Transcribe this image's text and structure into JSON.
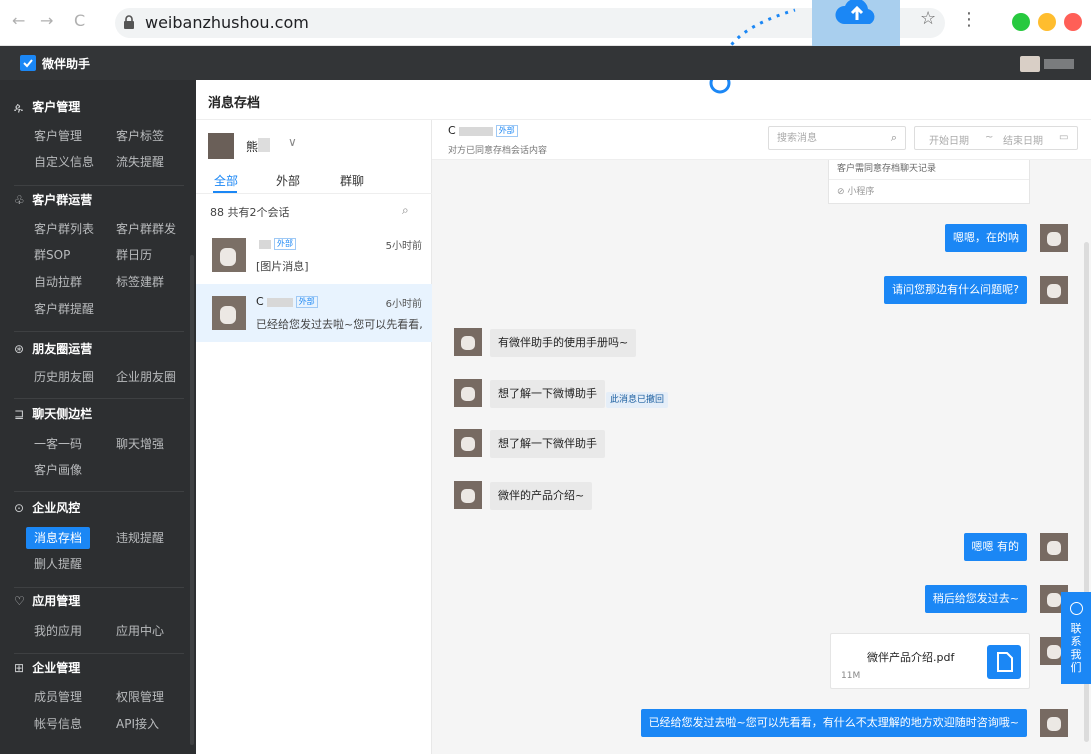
{
  "browser": {
    "url": "weibanzhushou.com",
    "back": "←",
    "forward": "→",
    "reload": "C"
  },
  "app": {
    "logo_text": "微伴助手",
    "page_title": "消息存档"
  },
  "sidebar": {
    "sections": [
      {
        "title": "客户管理",
        "icon": "user-icon",
        "items": [
          "客户管理",
          "客户标签",
          "自定义信息",
          "流失提醒"
        ]
      },
      {
        "title": "客户群运营",
        "icon": "group-icon",
        "items": [
          "客户群列表",
          "客户群群发",
          "群SOP",
          "群日历",
          "自动拉群",
          "标签建群",
          "客户群提醒"
        ]
      },
      {
        "title": "朋友圈运营",
        "icon": "moments-icon",
        "items": [
          "历史朋友圈",
          "企业朋友圈"
        ]
      },
      {
        "title": "聊天侧边栏",
        "icon": "sidebar-icon",
        "items": [
          "一客一码",
          "聊天增强",
          "客户画像"
        ]
      },
      {
        "title": "企业风控",
        "icon": "shield-icon",
        "items": [
          "消息存档",
          "违规提醒",
          "删人提醒"
        ]
      },
      {
        "title": "应用管理",
        "icon": "app-icon",
        "items": [
          "我的应用",
          "应用中心"
        ]
      },
      {
        "title": "企业管理",
        "icon": "building-icon",
        "items": [
          "成员管理",
          "权限管理",
          "帐号信息",
          "API接入"
        ]
      }
    ],
    "active_item": "消息存档"
  },
  "conversations": {
    "user_name_initial": "熊",
    "tabs": [
      "全部",
      "外部",
      "群聊"
    ],
    "active_tab": "全部",
    "count_label": "共有2个会话",
    "items": [
      {
        "name_initial": "",
        "tag": "外部",
        "time": "5小时前",
        "preview": "[图片消息]"
      },
      {
        "name_initial": "C",
        "tag": "外部",
        "time": "6小时前",
        "preview": "已经给您发过去啦~您可以先看看, ..."
      }
    ]
  },
  "chat": {
    "contact_initial": "C",
    "contact_tag": "外部",
    "subtitle": "对方已同意存档会话内容",
    "search_placeholder": "搜索消息",
    "start_date_placeholder": "开始日期",
    "date_separator": "~",
    "end_date_placeholder": "结束日期",
    "mini_program_text": "客户需同意存档聊天记录",
    "mini_program_label": "小程序",
    "messages": [
      {
        "dir": "out",
        "text": "嗯嗯，在的呐"
      },
      {
        "dir": "out",
        "text": "请问您那边有什么问题呢?"
      },
      {
        "dir": "in",
        "text": "有微伴助手的使用手册吗~"
      },
      {
        "dir": "in",
        "text": "想了解一下微博助手",
        "recalled": "此消息已撤回"
      },
      {
        "dir": "in",
        "text": "想了解一下微伴助手"
      },
      {
        "dir": "in",
        "text": "微伴的产品介绍~"
      },
      {
        "dir": "out",
        "text": "嗯嗯 有的"
      },
      {
        "dir": "out",
        "text": "稍后给您发过去~"
      },
      {
        "dir": "out",
        "type": "file",
        "file_name": "微伴产品介绍.pdf",
        "file_size": "11M"
      },
      {
        "dir": "out",
        "text": "已经给您发过去啦~您可以先看看，有什么不太理解的地方欢迎随时咨询哦~"
      }
    ]
  },
  "contact_us": "联系我们",
  "colors": {
    "accent": "#1b87f5",
    "sidebar_bg": "#2d2f31",
    "topbar_bg": "#333537",
    "upload_highlight": "#a9cfee",
    "traffic_green": "#27c93f",
    "traffic_yellow": "#ffbd2e",
    "traffic_red": "#ff5f57"
  }
}
